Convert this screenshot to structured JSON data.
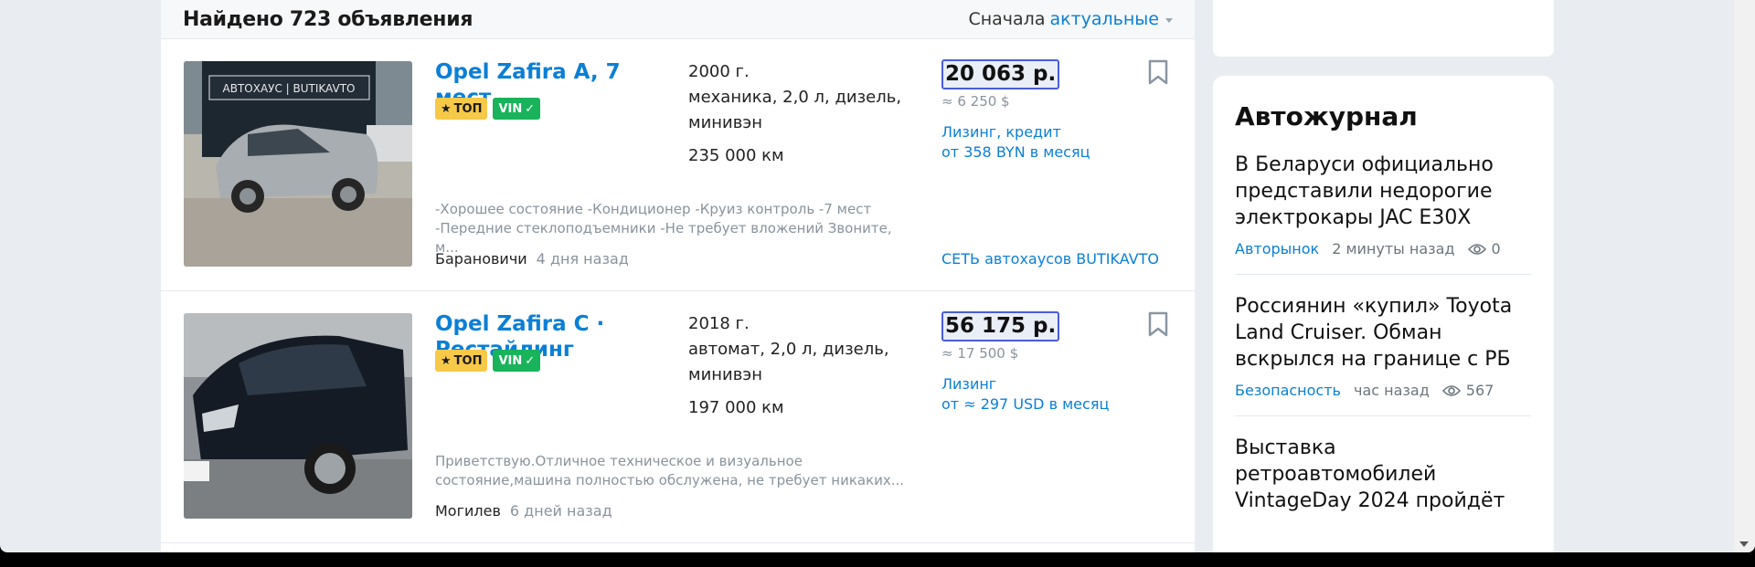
{
  "header": {
    "count_text": "Найдено 723 объявления",
    "sort_prefix": "Сначала",
    "sort_value": "актуальные"
  },
  "listings": [
    {
      "title": "Opel Zafira A, 7 мест",
      "badge_top": "ТОП",
      "badge_vin": "VIN",
      "year": "2000 г.",
      "spec": "механика, 2,0 л, дизель, минивэн",
      "mileage": "235 000 км",
      "price": "20 063 р.",
      "price_usd": "≈ 6 250 $",
      "credit_line1": "Лизинг, кредит",
      "credit_line2": "от 358 BYN в месяц",
      "description": "-Хорошее состояние -Кондиционер -Круиз контроль -7 мест -Передние стеклоподъемники -Не требует вложений Звоните, м...",
      "city": "Барановичи",
      "time": "4 дня назад",
      "seller": "СЕТЬ автохаусов BUTIKAVTO",
      "photo_sign": "АВТОХАУС | BUTIKAVTO"
    },
    {
      "title": "Opel Zafira C · Рестайлинг",
      "badge_top": "ТОП",
      "badge_vin": "VIN",
      "year": "2018 г.",
      "spec": "автомат, 2,0 л, дизель, минивэн",
      "mileage": "197 000 км",
      "price": "56 175 р.",
      "price_usd": "≈ 17 500 $",
      "credit_line1": "Лизинг",
      "credit_line2": "от ≈ 297 USD в месяц",
      "description": "Приветствую.Отличное техническое и визуальное состояние,машина полностью обслужена, не требует никаких...",
      "city": "Могилев",
      "time": "6 дней назад",
      "seller": ""
    }
  ],
  "sidebar": {
    "title": "Автожурнал",
    "articles": [
      {
        "title": "В Беларуси официально представили недорогие электрокары JAC E30X",
        "category": "Авторынок",
        "time": "2 минуты назад",
        "views": "0"
      },
      {
        "title": "Россиянин «купил» Toyota Land Cruiser. Обман вскрылся на границе с РБ",
        "category": "Безопасность",
        "time": "час назад",
        "views": "567"
      },
      {
        "title": "Выставка ретроавтомобилей VintageDay 2024 пройдёт",
        "category": "",
        "time": "",
        "views": ""
      }
    ]
  },
  "colors": {
    "link": "#0b7fd6",
    "badge_top": "#f7c948",
    "badge_vin": "#19b35c",
    "price_border": "#4a5dd8"
  },
  "icons": [
    "bookmark-icon",
    "star-icon",
    "check-icon",
    "eye-icon",
    "chevron-down-icon"
  ]
}
